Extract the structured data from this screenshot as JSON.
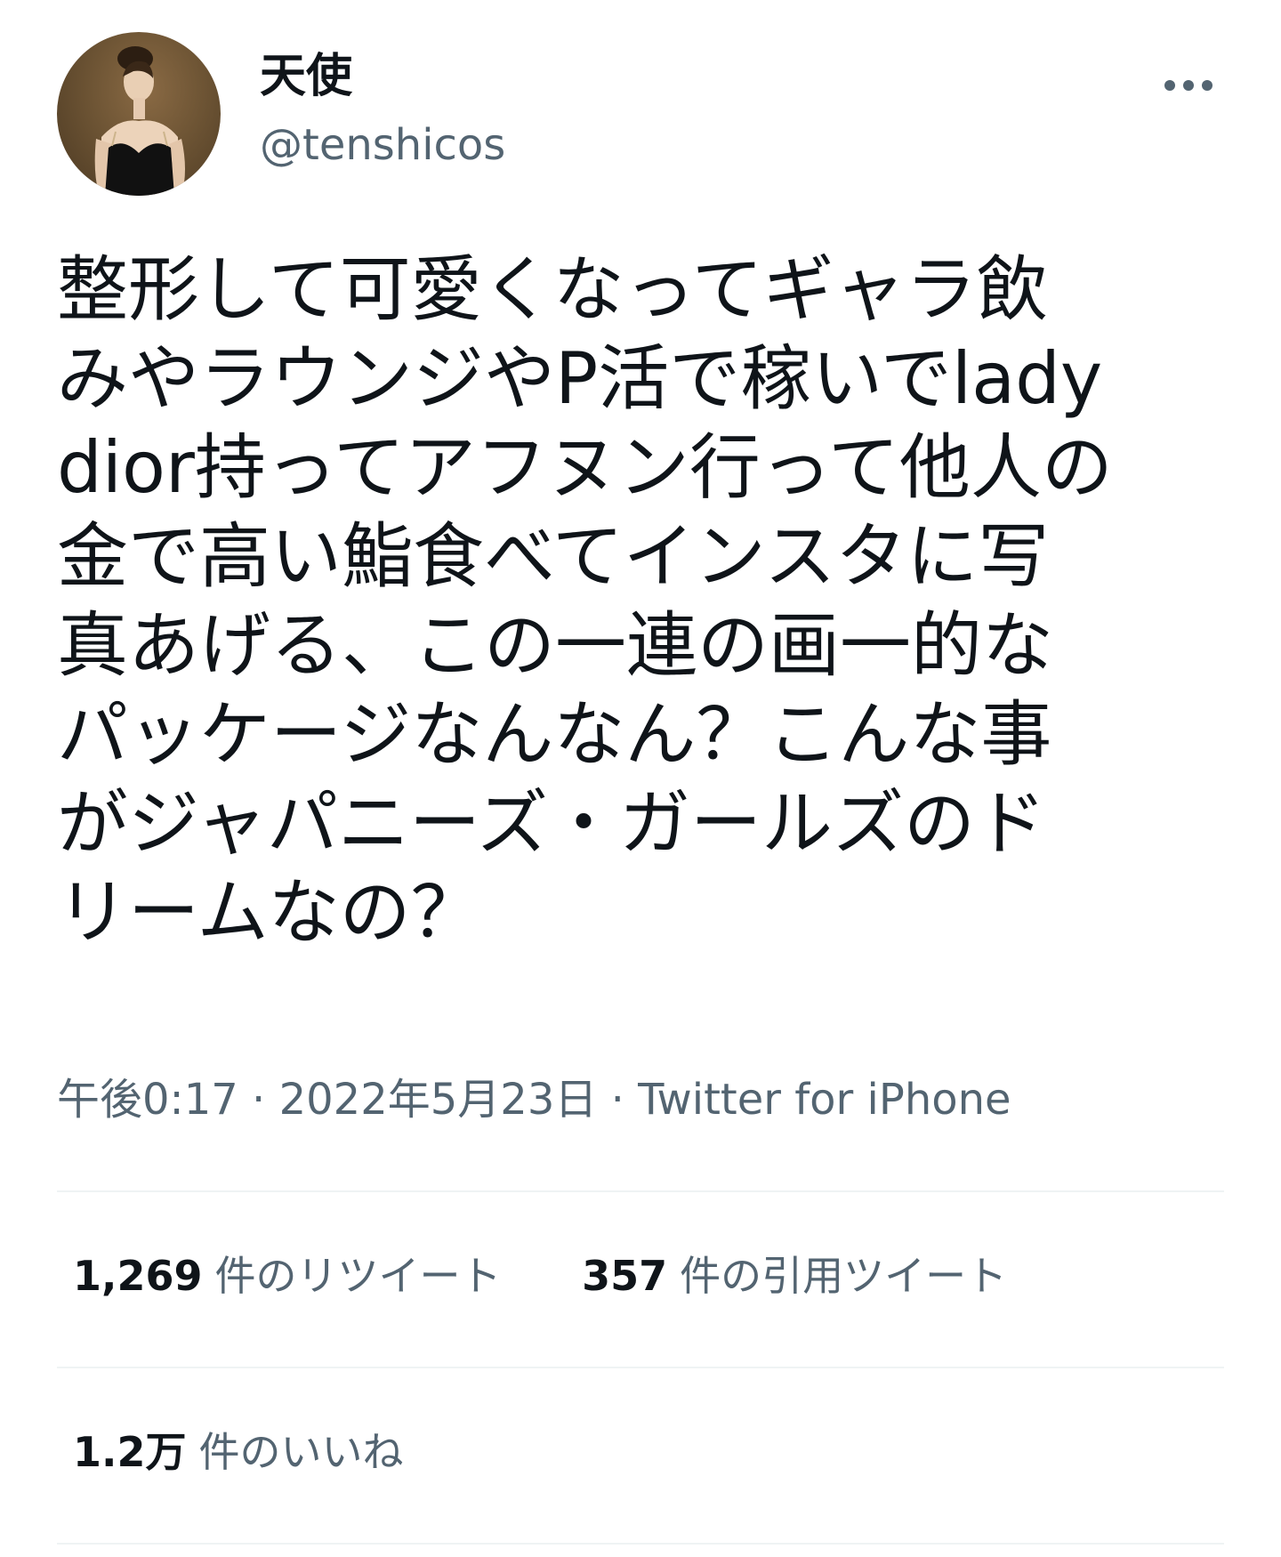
{
  "author": {
    "display_name": "天使",
    "handle": "@tenshicos",
    "avatar_icon": "portrait-avatar"
  },
  "more_icon": "more-horizontal-icon",
  "tweet": {
    "lines": [
      "整形して可愛くなってギャラ飲",
      "みやラウンジやP活で稼いでlady",
      "dior持ってアフヌン行って他人の",
      "金で高い鮨食べてインスタに写",
      "真あげる、この一連の画一的な",
      "パッケージなんなん？こんな事",
      "がジャパニーズ・ガールズのド",
      "リームなの？"
    ],
    "time": "午後0:17",
    "separator": " · ",
    "date": "2022年5月23日",
    "source": "Twitter for iPhone"
  },
  "stats": {
    "retweets": {
      "count": "1,269",
      "label": "件のリツイート"
    },
    "quotes": {
      "count": "357",
      "label": "件の引用ツイート"
    },
    "likes": {
      "count": "1.2万",
      "label": "件のいいね"
    }
  },
  "colors": {
    "text_primary": "#0f1419",
    "text_secondary": "#536471",
    "divider": "#eff3f4"
  }
}
